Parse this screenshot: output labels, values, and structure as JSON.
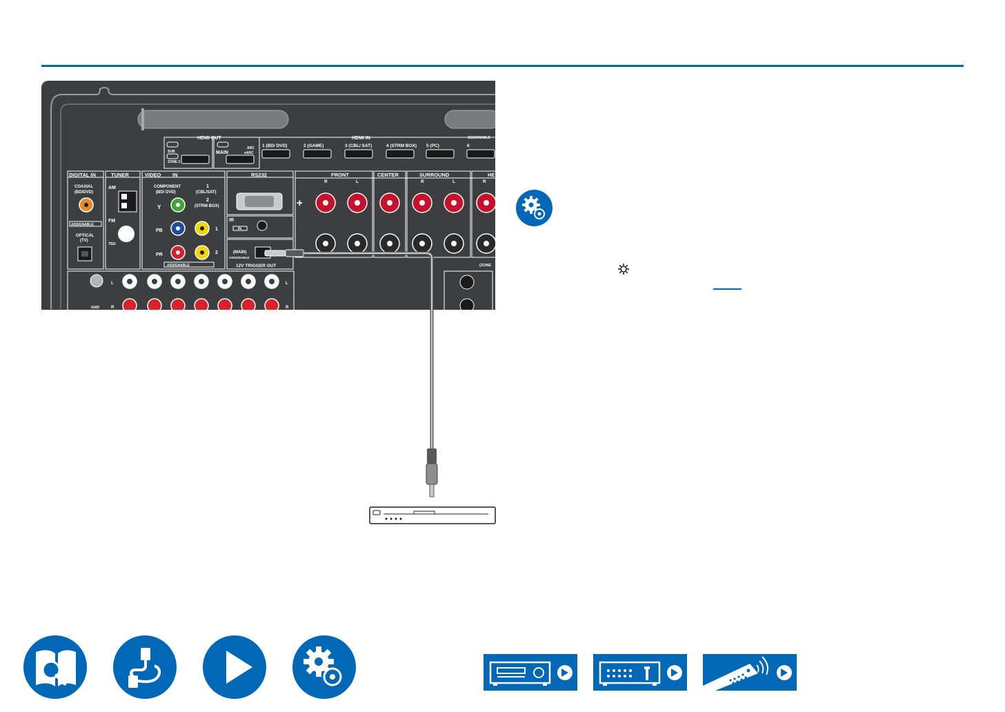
{
  "panel": {
    "hdmi_out": "HDMI OUT",
    "hdmi_in": "HDMI IN",
    "hdmi_sub": "SUB",
    "hdmi_zone2": "ZONE 2",
    "hdmi_main": "MAIN",
    "hdmi_arc": "ARC",
    "hdmi_earc": "eARC",
    "hdmi_inputs": [
      "1 (BD/ DVD)",
      "2 (GAME)",
      "3 (CBL/ SAT)",
      "4 (STRM BOX)",
      "5 (PC)",
      "6"
    ],
    "assignable_top": "ASSIGNABLE",
    "digital_in": "DIGITAL IN",
    "coaxial": "COAXIAL",
    "coaxial_sub": "(BD/DVD)",
    "assignable_digital": "ASSIGNABLE",
    "optical": "OPTICAL",
    "optical_sub": "(TV)",
    "tuner": "TUNER",
    "am": "AM",
    "fm": "FM",
    "fm_ohm": "75Ω",
    "video": "VIDEO",
    "in": "IN",
    "component": "COMPONENT",
    "component_sub": "(BD/ DVD)",
    "y": "Y",
    "pb": "PB",
    "pr": "PR",
    "video_1": "1",
    "video_1_sub": "(CBL/SAT)",
    "video_2": "2",
    "video_2_sub": "(STRM BOX)",
    "video_row1": "1",
    "video_row2": "2",
    "assignable_video": "ASSIGNABLE",
    "rs232": "RS232",
    "ir": "IR",
    "ir_in": "IN",
    "main": "(MAIN)",
    "assignable_trigger": "ASSIGNABLE",
    "trigger": "12V TRIGGER OUT",
    "front": "FRONT",
    "center": "CENTER",
    "surround": "SURROUND",
    "height_cut": "HE",
    "r": "R",
    "l": "L",
    "plus": "+",
    "minus": "–",
    "zone_cut": "(ZONE",
    "gnd": "GND"
  },
  "footer": {
    "nav_left": [
      "contents-book-icon",
      "connections-cable-icon",
      "playback-icon",
      "setup-gear-icon"
    ],
    "nav_right": [
      "front-panel-icon",
      "rear-panel-icon",
      "remote-control-icon"
    ]
  },
  "colors": {
    "accent": "#0068b7",
    "panel": "#3d3e40",
    "speaker_red": "#c8102e",
    "rca_yellow": "#f3d600",
    "rca_green": "#3fa535",
    "rca_blue": "#1d4fa0",
    "rca_red": "#d6232b",
    "coax_orange": "#e38b22"
  }
}
